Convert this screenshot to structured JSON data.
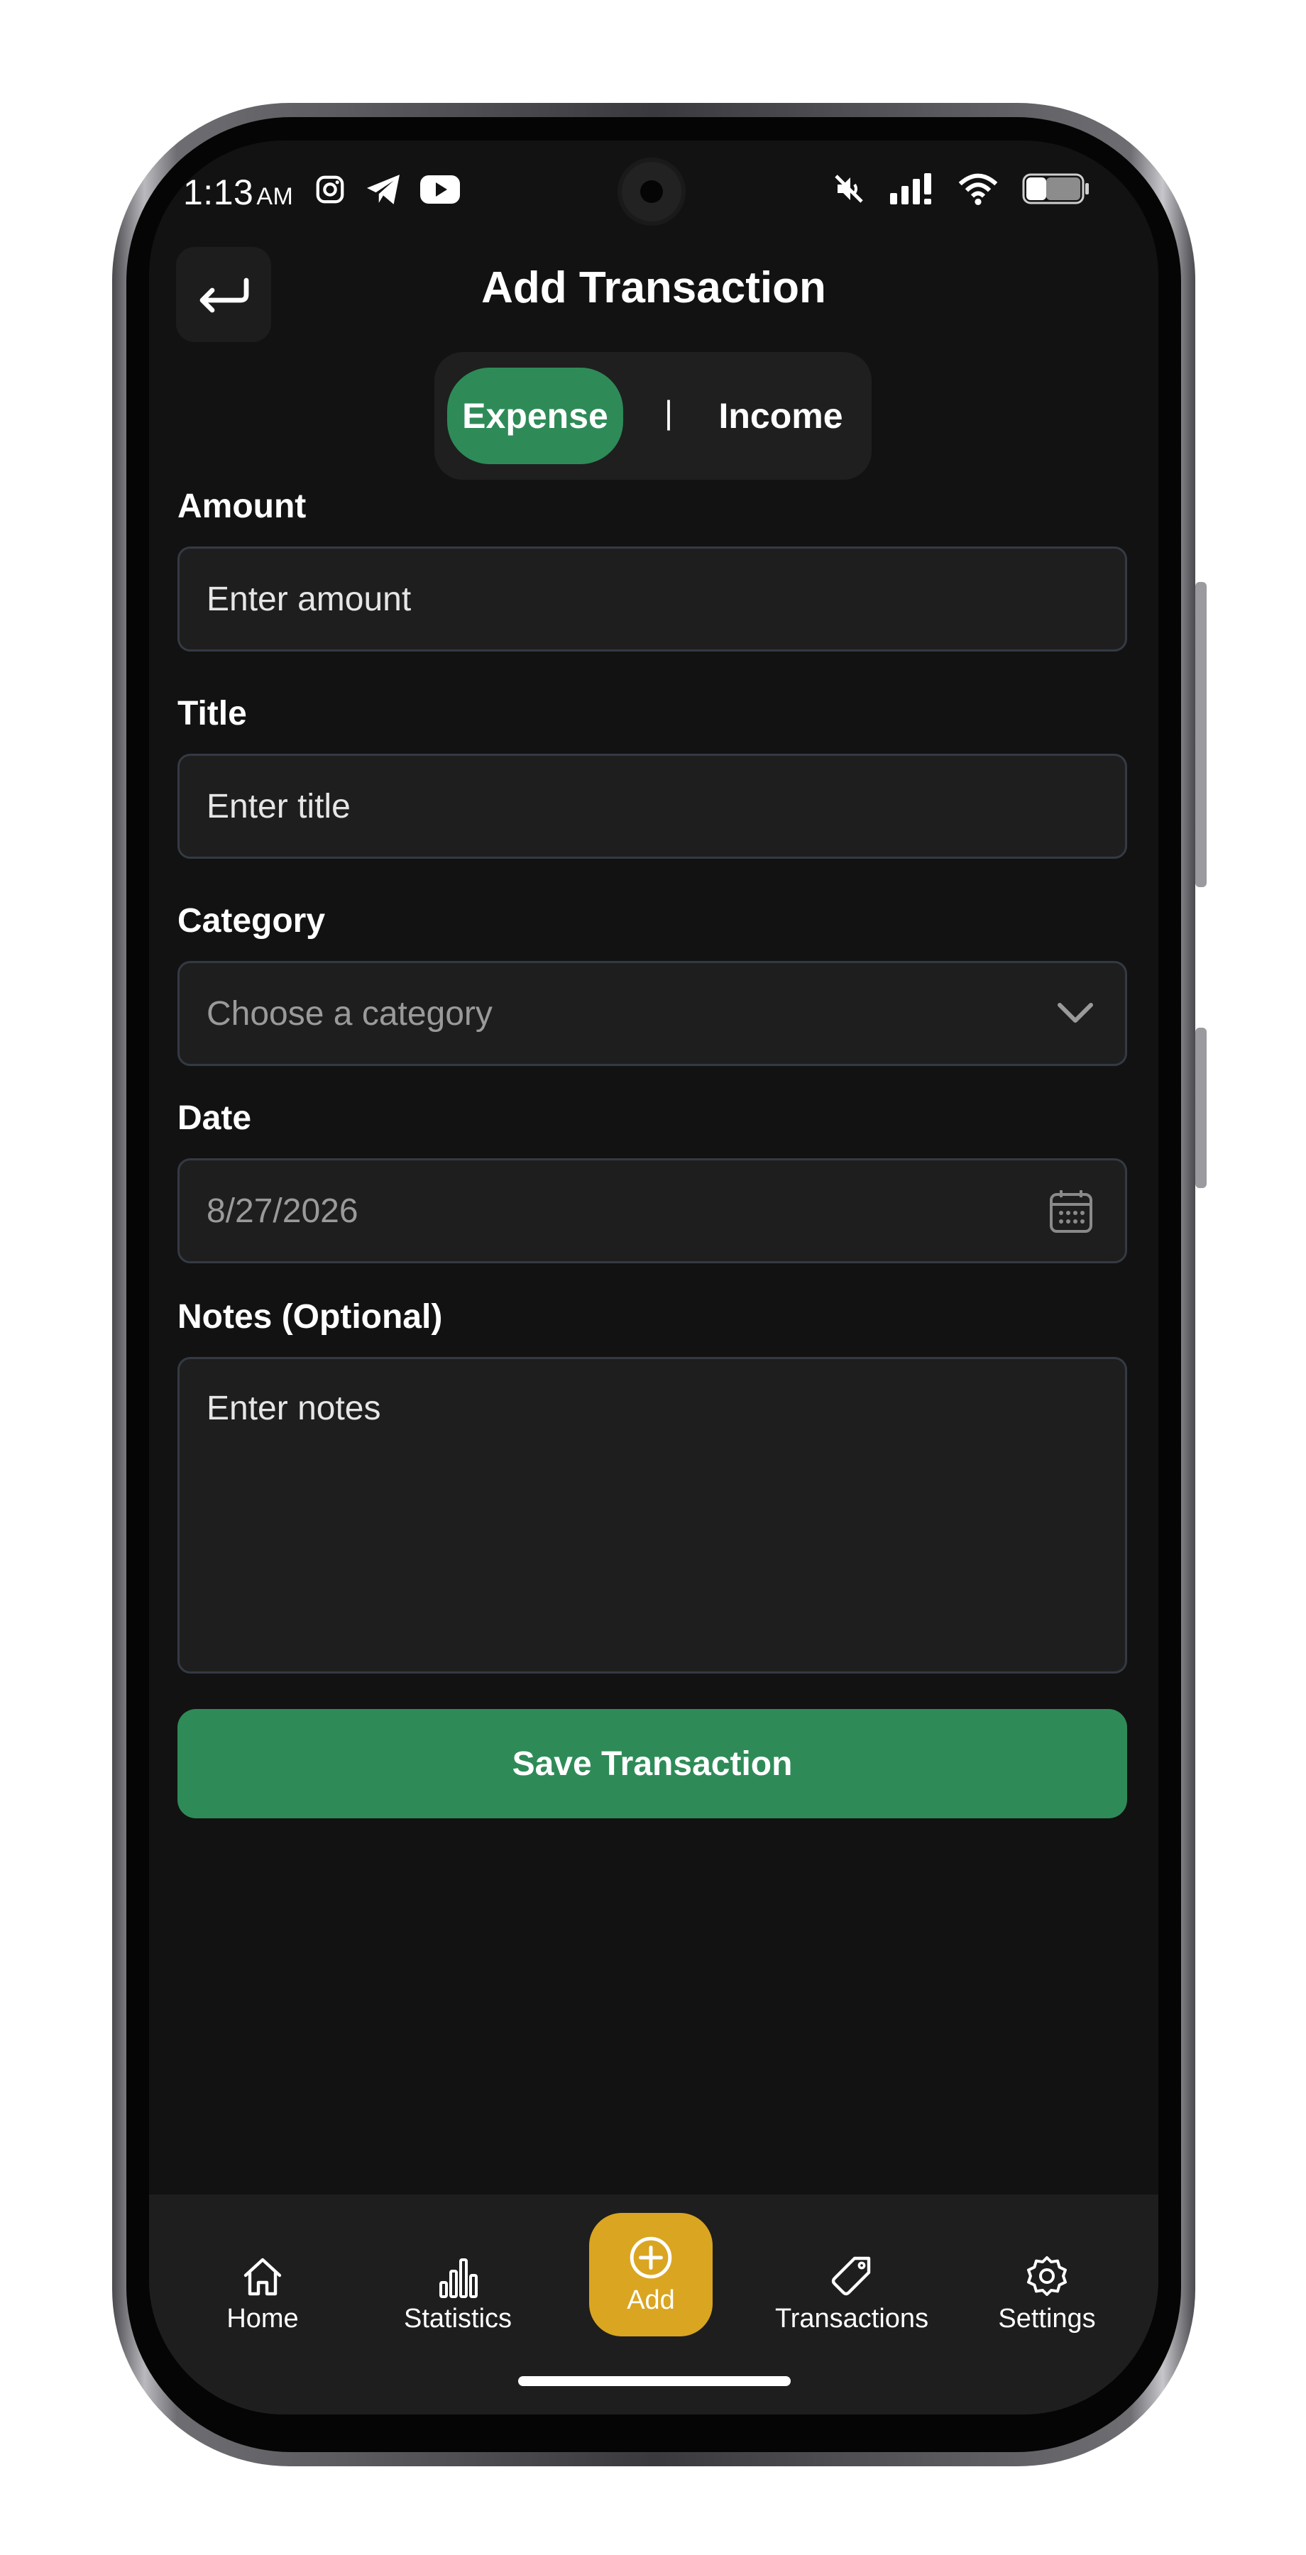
{
  "status_bar": {
    "time": "1:13",
    "ampm": "AM"
  },
  "header": {
    "title": "Add Transaction",
    "back_icon": "return-arrow-icon"
  },
  "type_toggle": {
    "options": [
      "Expense",
      "Income"
    ],
    "separator": "|",
    "selected": "Expense",
    "selected_color": "#2e8b57"
  },
  "form": {
    "amount": {
      "label": "Amount",
      "placeholder": "Enter amount",
      "value": ""
    },
    "title": {
      "label": "Title",
      "placeholder": "Enter title",
      "value": ""
    },
    "category": {
      "label": "Category",
      "placeholder": "Choose a category",
      "icon": "chevron-down-icon"
    },
    "date": {
      "label": "Date",
      "value": "8/27/2026",
      "icon": "calendar-icon"
    },
    "notes": {
      "label": "Notes (Optional)",
      "placeholder": "Enter notes",
      "value": ""
    },
    "save_label": "Save Transaction"
  },
  "bottom_nav": {
    "items": [
      {
        "label": "Home",
        "icon": "home-icon"
      },
      {
        "label": "Statistics",
        "icon": "bar-chart-icon"
      },
      {
        "label": "Add",
        "icon": "plus-circle-icon",
        "active": true
      },
      {
        "label": "Transactions",
        "icon": "tag-icon"
      },
      {
        "label": "Settings",
        "icon": "gear-icon"
      }
    ],
    "active_color": "#daa520"
  },
  "colors": {
    "background": "#121212",
    "surface": "#1e1e1e",
    "accent_green": "#2e8b57",
    "accent_gold": "#daa520"
  }
}
